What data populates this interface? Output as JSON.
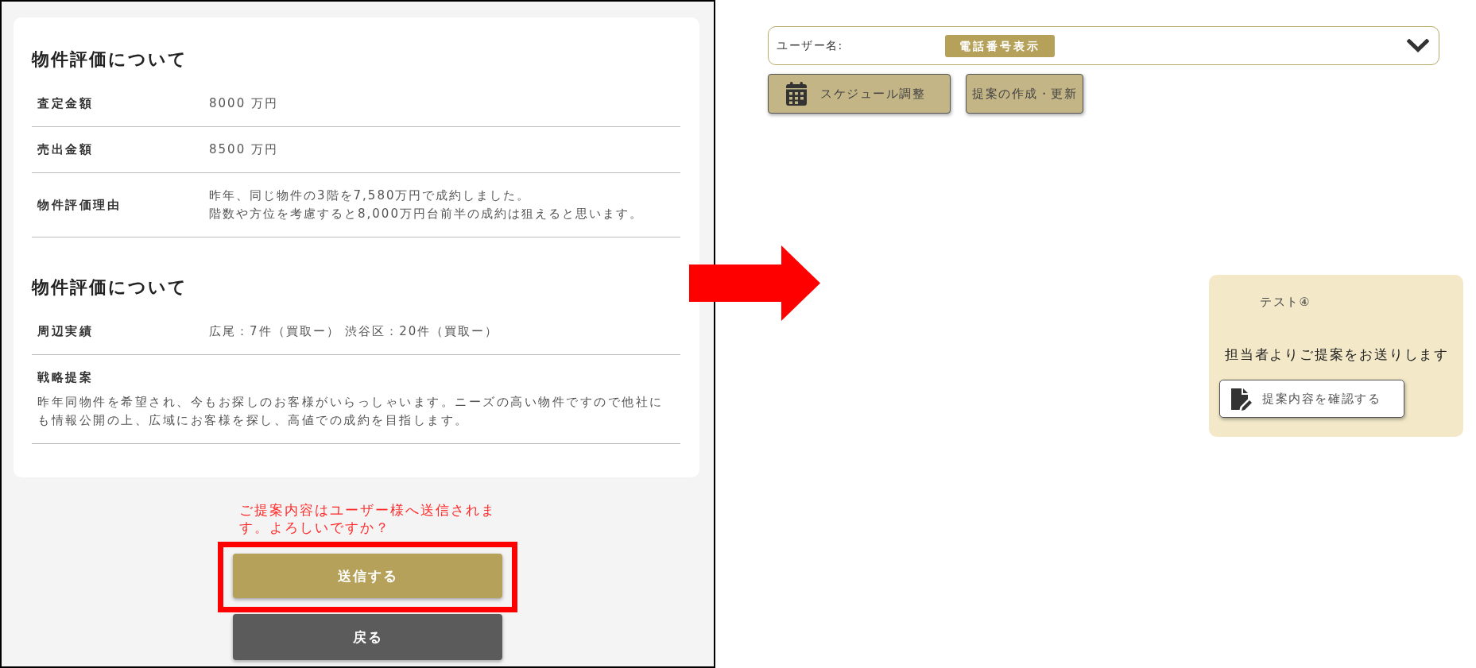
{
  "confirm_panel": {
    "sections": [
      {
        "title": "物件評価について",
        "rows": [
          {
            "kind": "inline",
            "label": "査定金額",
            "lines": [
              "8000 万円"
            ]
          },
          {
            "kind": "inline",
            "label": "売出金額",
            "lines": [
              "8500 万円"
            ]
          },
          {
            "kind": "inline",
            "label": "物件評価理由",
            "lines": [
              "昨年、同じ物件の3階を7,580万円で成約しました。",
              "階数や方位を考慮すると8,000万円台前半の成約は狙えると思います。"
            ]
          }
        ]
      },
      {
        "title": "物件評価について",
        "rows": [
          {
            "kind": "inline",
            "label": "周辺実績",
            "lines": [
              "広尾：7件（買取ー） 渋谷区：20件（買取ー）"
            ]
          },
          {
            "kind": "stacked",
            "label": "戦略提案",
            "lines": [
              "昨年同物件を希望され、今もお探しのお客様がいらっしゃいます。ニーズの高い物件ですので他社にも情報公開の上、広域にお客様を探し、高値での成約を目指します。"
            ]
          }
        ]
      }
    ],
    "confirm_message": "ご提案内容はユーザー様へ送信されます。よろしいですか？",
    "send_button": {
      "label": "送信する",
      "highlighted": true
    },
    "back_button": {
      "label": "戻る"
    }
  },
  "user_bar": {
    "label": "ユーザー名:",
    "badge": "電話番号表示"
  },
  "actions": [
    {
      "kind": "icon_button",
      "label": "スケジュール調整"
    },
    {
      "kind": "text_button",
      "label": "提案の作成・更新"
    }
  ],
  "notice_card": {
    "title": "テスト④",
    "message": "担当者よりご提案をお送りします",
    "button": "提案内容を確認する"
  }
}
